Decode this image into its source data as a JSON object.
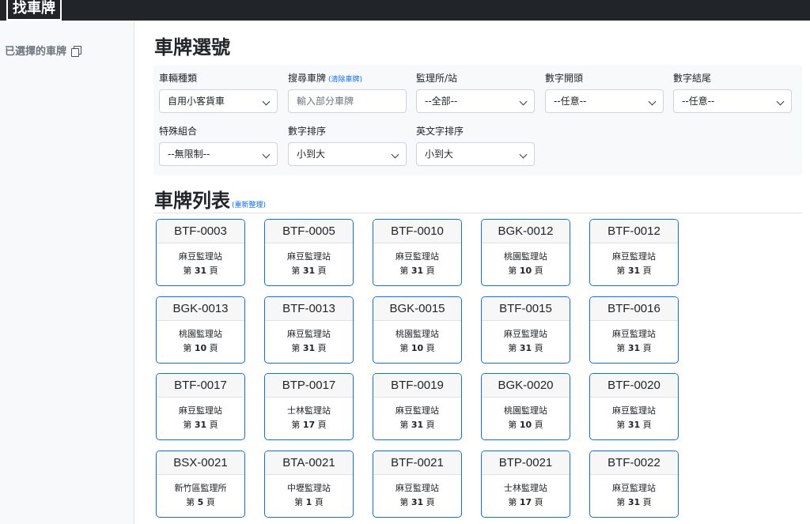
{
  "header": {
    "brand": "找車牌"
  },
  "sidebar": {
    "selected_label": "已選擇的車牌"
  },
  "main": {
    "title": "車牌選號",
    "filters": {
      "vehicle_type": {
        "label": "車輛種類",
        "value": "自用小客貨車"
      },
      "search": {
        "label": "搜尋車牌",
        "clear_link": "(清除車牌)",
        "placeholder": "輸入部分車牌"
      },
      "station": {
        "label": "監理所/站",
        "value": "--全部--"
      },
      "digit_start": {
        "label": "數字開頭",
        "value": "--任意--"
      },
      "digit_end": {
        "label": "數字結尾",
        "value": "--任意--"
      },
      "special_combo": {
        "label": "特殊組合",
        "value": "--無限制--"
      },
      "digit_sort": {
        "label": "數字排序",
        "value": "小到大"
      },
      "letter_sort": {
        "label": "英文字排序",
        "value": "小到大"
      }
    },
    "list_title": "車牌列表",
    "reorganize_link": "(重新整理)",
    "page_prefix": "第",
    "page_suffix": "頁",
    "plates": [
      {
        "plate": "BTF-0003",
        "station": "麻豆監理站",
        "page": "31"
      },
      {
        "plate": "BTF-0005",
        "station": "麻豆監理站",
        "page": "31"
      },
      {
        "plate": "BTF-0010",
        "station": "麻豆監理站",
        "page": "31"
      },
      {
        "plate": "BGK-0012",
        "station": "桃園監理站",
        "page": "10"
      },
      {
        "plate": "BTF-0012",
        "station": "麻豆監理站",
        "page": "31"
      },
      {
        "plate": "BGK-0013",
        "station": "桃園監理站",
        "page": "10"
      },
      {
        "plate": "BTF-0013",
        "station": "麻豆監理站",
        "page": "31"
      },
      {
        "plate": "BGK-0015",
        "station": "桃園監理站",
        "page": "10"
      },
      {
        "plate": "BTF-0015",
        "station": "麻豆監理站",
        "page": "31"
      },
      {
        "plate": "BTF-0016",
        "station": "麻豆監理站",
        "page": "31"
      },
      {
        "plate": "BTF-0017",
        "station": "麻豆監理站",
        "page": "31"
      },
      {
        "plate": "BTP-0017",
        "station": "士林監理站",
        "page": "17"
      },
      {
        "plate": "BTF-0019",
        "station": "麻豆監理站",
        "page": "31"
      },
      {
        "plate": "BGK-0020",
        "station": "桃園監理站",
        "page": "10"
      },
      {
        "plate": "BTF-0020",
        "station": "麻豆監理站",
        "page": "31"
      },
      {
        "plate": "BSX-0021",
        "station": "新竹區監理所",
        "page": "5"
      },
      {
        "plate": "BTA-0021",
        "station": "中壢監理站",
        "page": "1"
      },
      {
        "plate": "BTF-0021",
        "station": "麻豆監理站",
        "page": "31"
      },
      {
        "plate": "BTP-0021",
        "station": "士林監理站",
        "page": "17"
      },
      {
        "plate": "BTF-0022",
        "station": "麻豆監理站",
        "page": "31"
      }
    ]
  }
}
